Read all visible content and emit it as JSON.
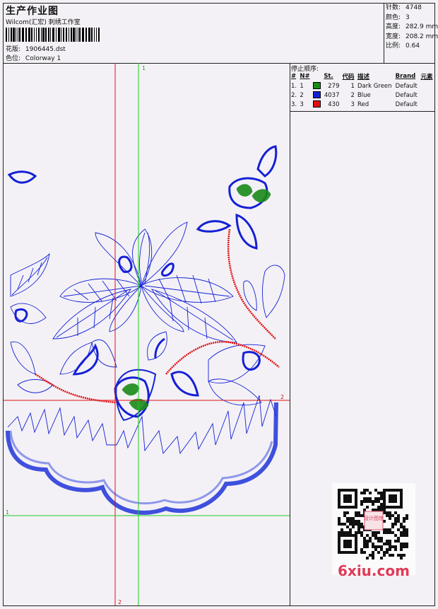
{
  "header": {
    "title": "生产作业图",
    "subtitle": "Wilcom(汇宏) 刺绣工作室",
    "design_label": "花版:",
    "design_value": "1906445.dst",
    "colorway_label": "色位:",
    "colorway_value": "Colorway 1"
  },
  "stats": [
    {
      "label": "针数:",
      "value": "4748"
    },
    {
      "label": "颜色:",
      "value": "3"
    },
    {
      "label": "高度:",
      "value": "282.9 mm"
    },
    {
      "label": "宽度:",
      "value": "208.2 mm"
    },
    {
      "label": "比例:",
      "value": "0.64"
    }
  ],
  "sequence": {
    "title": "停止顺序:",
    "headers": [
      "#",
      "N#",
      "St.",
      "代码",
      "描述",
      "Brand",
      "元素"
    ],
    "rows": [
      {
        "idx": "1.",
        "n": "1",
        "color": "#1a8a1a",
        "st": "279",
        "code": "1",
        "desc": "Dark Green",
        "brand": "Default"
      },
      {
        "idx": "2.",
        "n": "2",
        "color": "#1420d6",
        "st": "4037",
        "code": "2",
        "desc": "Blue",
        "brand": "Default"
      },
      {
        "idx": "3.",
        "n": "3",
        "color": "#e01010",
        "st": "430",
        "code": "3",
        "desc": "Red",
        "brand": "Default"
      }
    ]
  },
  "guides": {
    "v1_label": "1",
    "v2_label": "2",
    "h1_label": "1",
    "h2_label": "2"
  },
  "watermark": {
    "site": "6xiu.com",
    "stamp": "设计图馆"
  },
  "colors": {
    "blue": "#1420d6",
    "green": "#1a8a1a",
    "red": "#e01010",
    "guide_green": "#22cc22",
    "guide_red": "#dd1111"
  }
}
